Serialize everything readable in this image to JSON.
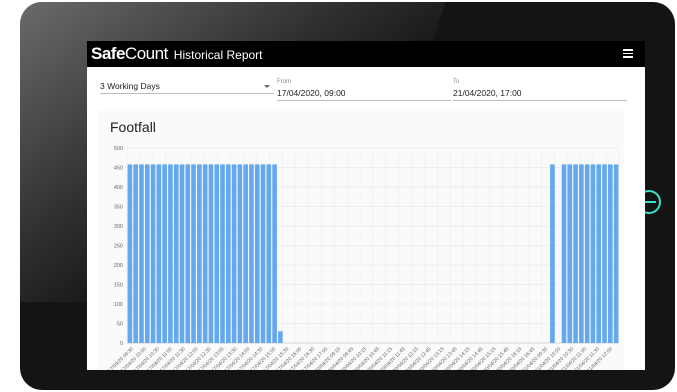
{
  "app": {
    "brand_bold": "Safe",
    "brand_light": "Count",
    "page_title": "Historical Report"
  },
  "filters": {
    "period": "3 Working Days",
    "from_label": "From",
    "from_value": "17/04/2020, 09:00",
    "to_label": "To",
    "to_value": "21/04/2020, 17:00"
  },
  "chart_data": {
    "type": "bar",
    "title": "Footfall",
    "ylim": [
      0,
      500
    ],
    "yticks": [
      0,
      50,
      100,
      150,
      200,
      250,
      300,
      350,
      400,
      450,
      500
    ],
    "grid": true,
    "bar_color": "#64a8ee",
    "categories": [
      "17/04/20 09:30",
      "17/04/20 10:00",
      "17/04/20 10:30",
      "17/04/20 11:00",
      "17/04/20 11:30",
      "17/04/20 12:00",
      "17/04/20 12:30",
      "17/04/20 13:00",
      "17/04/20 13:30",
      "17/04/20 14:00",
      "17/04/20 14:30",
      "17/04/20 15:00",
      "17/04/20 15:30",
      "17/04/20 16:00",
      "17/04/20 16:30",
      "17/04/20 17:00",
      "20/04/20 09:15",
      "20/04/20 09:45",
      "20/04/20 10:15",
      "20/04/20 10:45",
      "20/04/20 11:15",
      "20/04/20 11:45",
      "20/04/20 12:15",
      "20/04/20 12:45",
      "20/04/20 13:15",
      "20/04/20 13:45",
      "20/04/20 14:15",
      "20/04/20 14:45",
      "20/04/20 15:15",
      "20/04/20 15:45",
      "20/04/20 16:15",
      "20/04/20 16:45",
      "21/04/20 09:30",
      "21/04/20 10:00",
      "21/04/20 10:30",
      "21/04/20 11:00",
      "21/04/20 11:30",
      "21/04/20 12:00"
    ],
    "values": [
      458,
      458,
      458,
      458,
      458,
      458,
      458,
      458,
      458,
      458,
      458,
      458,
      458,
      458,
      458,
      458,
      458,
      458,
      458,
      458,
      458,
      458,
      458,
      458,
      458,
      458,
      30,
      0,
      0,
      0,
      0,
      0,
      0,
      0,
      0,
      0,
      0,
      0,
      0,
      0,
      0,
      0,
      0,
      0,
      0,
      0,
      0,
      0,
      0,
      0,
      0,
      0,
      0,
      0,
      0,
      0,
      0,
      0,
      0,
      0,
      0,
      0,
      0,
      0,
      0,
      0,
      0,
      0,
      0,
      0,
      0,
      0,
      0,
      458,
      0,
      458,
      458,
      458,
      458,
      458,
      458,
      458,
      458,
      458,
      458
    ]
  }
}
